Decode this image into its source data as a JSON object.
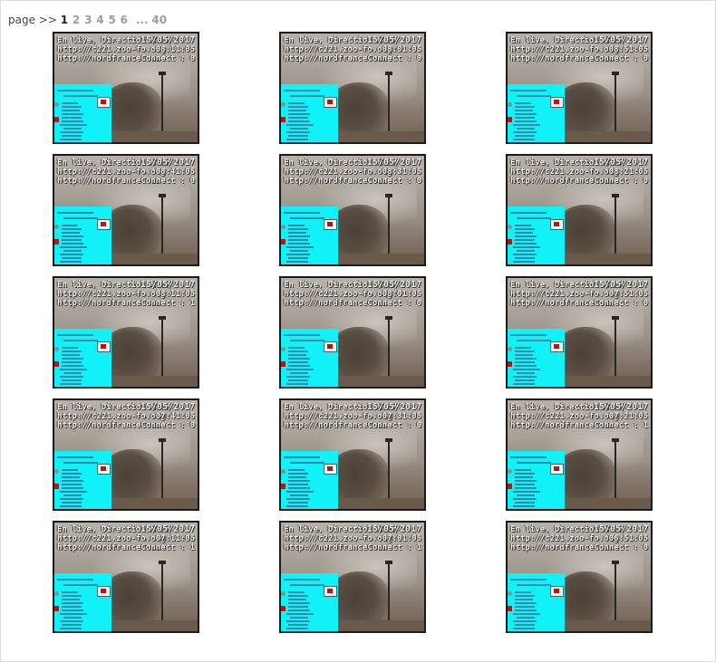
{
  "pager": {
    "label": "page >>",
    "pages": [
      "1",
      "2",
      "3",
      "4",
      "5",
      "6"
    ],
    "current": "1",
    "ellipsis": "...",
    "last": "40"
  },
  "thumbnails": [
    {
      "line1": "En live, Direction Nord",
      "date": "15/05/2017",
      "line2": "http://c221.zoo-fo.org",
      "time": "08:11:05",
      "line3": "http://nordfrance.com",
      "connect": "Connect : 0"
    },
    {
      "line1": "En live, Direction Nord",
      "date": "15/05/2017",
      "line2": "http://c221.zoo-fo.org",
      "time": "08:01:05",
      "line3": "http://nordfrance.com",
      "connect": "Connect : 0"
    },
    {
      "line1": "En live, Direction Nord",
      "date": "15/05/2017",
      "line2": "http://c221.zoo-fo.org",
      "time": "08:51:05",
      "line3": "http://nordfrance.com",
      "connect": "Connect : 0"
    },
    {
      "line1": "En live, Direction Nord",
      "date": "15/05/2017",
      "line2": "http://c221.zoo-fo.org",
      "time": "08:41:05",
      "line3": "http://nordfrance.com",
      "connect": "Connect : 0"
    },
    {
      "line1": "En live, Direction Nord",
      "date": "15/05/2017",
      "line2": "http://c221.zoo-fo.org",
      "time": "08:31:05",
      "line3": "http://nordfrance.com",
      "connect": "Connect : 0"
    },
    {
      "line1": "En live, Direction Nord",
      "date": "15/05/2017",
      "line2": "http://c221.zoo-fo.org",
      "time": "08:21:05",
      "line3": "http://nordfrance.com",
      "connect": "Connect : 0"
    },
    {
      "line1": "En live, Direction Nord",
      "date": "15/05/2017",
      "line2": "http://c221.zoo-fo.org",
      "time": "08:11:05",
      "line3": "http://nordfrance.com",
      "connect": "Connect : 1"
    },
    {
      "line1": "En live, Direction Nord",
      "date": "15/05/2017",
      "line2": "http://c221.zoo-fo.org",
      "time": "08:01:05",
      "line3": "http://nordfrance.com",
      "connect": "Connect : 0"
    },
    {
      "line1": "En live, Direction Nord",
      "date": "15/05/2017",
      "line2": "http://c221.zoo-fo.org",
      "time": "07:51:05",
      "line3": "http://nordfrance.com",
      "connect": "Connect : 0"
    },
    {
      "line1": "En live, Direction Nord",
      "date": "15/05/2017",
      "line2": "http://c221.zoo-fo.org",
      "time": "07:41:05",
      "line3": "http://nordfrance.com",
      "connect": "Connect : 0"
    },
    {
      "line1": "En live, Direction Nord",
      "date": "15/05/2017",
      "line2": "http://c221.zoo-fo.org",
      "time": "07:31:05",
      "line3": "http://nordfrance.com",
      "connect": "Connect : 0"
    },
    {
      "line1": "En live, Direction Nord",
      "date": "15/05/2017",
      "line2": "http://c221.zoo-fo.org",
      "time": "07:21:05",
      "line3": "http://nordfrance.com",
      "connect": "Connect : 1"
    },
    {
      "line1": "En live, Direction Nord",
      "date": "15/05/2017",
      "line2": "http://c221.zoo-fo.org",
      "time": "07:11:05",
      "line3": "http://nordfrance.com",
      "connect": "Connect : 1"
    },
    {
      "line1": "En live, Direction Nord",
      "date": "15/05/2017",
      "line2": "http://c221.zoo-fo.org",
      "time": "07:01:05",
      "line3": "http://nordfrance.com",
      "connect": "Connect : 1"
    },
    {
      "line1": "En live, Direction Nord",
      "date": "15/05/2017",
      "line2": "http://c221.zoo-fo.org",
      "time": "06:51:05",
      "line3": "http://nordfrance.com",
      "connect": "Connect : 0"
    }
  ],
  "colors": {
    "panel": "#11f1f8",
    "border": "#1b1b1b",
    "current_page": "#222222",
    "other_pages": "#9c9c9c"
  }
}
